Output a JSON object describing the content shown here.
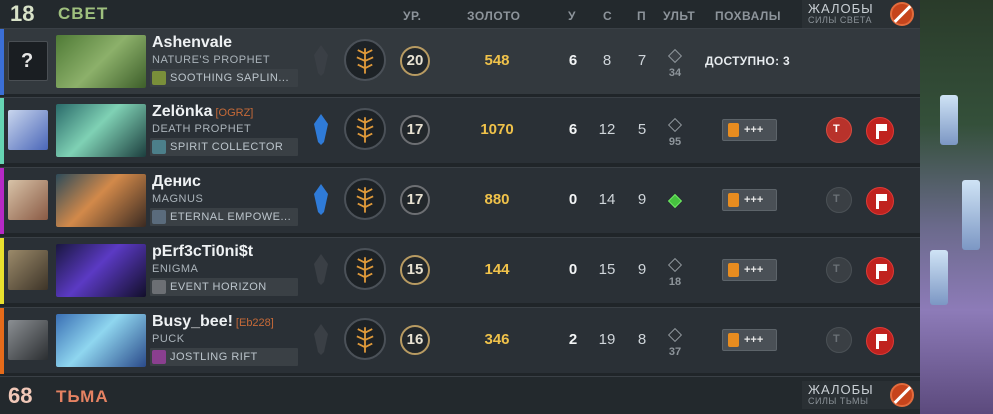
{
  "radiant": {
    "score": "18",
    "name": "СВЕТ"
  },
  "dire": {
    "score": "68",
    "name": "ТЬМА"
  },
  "columns": {
    "level": "УР.",
    "gold": "ЗОЛОТО",
    "kills": "У",
    "deaths": "С",
    "assists": "П",
    "ultimate": "УЛЬТ",
    "commends": "ПОХВАЛЫ"
  },
  "reports_panel": {
    "title": "ЖАЛОБЫ",
    "radiant_sub": "СИЛЫ СВЕТА",
    "dire_sub": "СИЛЫ ТЬМЫ"
  },
  "colors": {
    "slot1": "#3b6fd6",
    "slot2": "#66d5b4",
    "slot3": "#b629c5",
    "slot4": "#e8e02e",
    "slot5": "#e66b1a"
  },
  "players": [
    {
      "name": "Ashenvale",
      "tag": "",
      "hero": "NATURE'S PROPHET",
      "talent": "SOOTHING SAPLIN...",
      "level": "20",
      "gold": "548",
      "kills": "6",
      "deaths": "8",
      "assists": "7",
      "ult_cd": "34",
      "commend": "ДОСТУПНО: 3"
    },
    {
      "name": "Zelönka",
      "tag": "[OGRZ]",
      "hero": "DEATH PROPHET",
      "talent": "SPIRIT COLLECTOR",
      "level": "17",
      "gold": "1070",
      "kills": "6",
      "deaths": "12",
      "assists": "5",
      "ult_cd": "95",
      "commend": "+++"
    },
    {
      "name": "Денис",
      "tag": "",
      "hero": "MAGNUS",
      "talent": "ETERNAL EMPOWE...",
      "level": "17",
      "gold": "880",
      "kills": "0",
      "deaths": "14",
      "assists": "9",
      "ult_cd": "",
      "commend": "+++"
    },
    {
      "name": "pErf3cTi0ni$t",
      "tag": "",
      "hero": "ENIGMA",
      "talent": "EVENT HORIZON",
      "level": "15",
      "gold": "144",
      "kills": "0",
      "deaths": "15",
      "assists": "9",
      "ult_cd": "18",
      "commend": "+++"
    },
    {
      "name": "Busy_bee!",
      "tag": "[Eb228]",
      "hero": "PUCK",
      "talent": "JOSTLING RIFT",
      "level": "16",
      "gold": "346",
      "kills": "2",
      "deaths": "19",
      "assists": "8",
      "ult_cd": "37",
      "commend": "+++"
    }
  ]
}
